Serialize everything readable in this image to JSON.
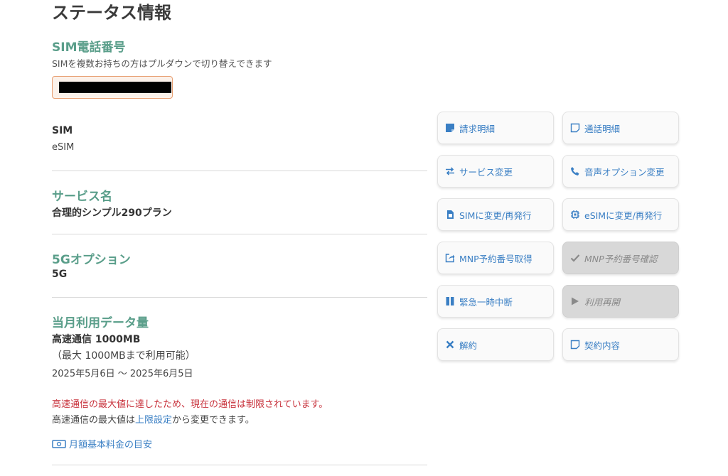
{
  "page": {
    "title": "ステータス情報"
  },
  "sim_number": {
    "title": "SIM電話番号",
    "hint": "SIMを複数お持ちの方はプルダウンで切り替えできます"
  },
  "sim": {
    "label": "SIM",
    "value": "eSIM"
  },
  "service": {
    "title": "サービス名",
    "value": "合理的シンプル290プラン"
  },
  "option5g": {
    "title": "5Gオプション",
    "value": "5G"
  },
  "data_usage": {
    "title": "当月利用データ量",
    "value": "高速通信 1000MB",
    "max": "（最大 1000MBまで利用可能）",
    "period": "2025年5月6日 〜 2025年6月5日",
    "warning": "高速通信の最大値に達したため、現在の通信は制限されています。",
    "note_prefix": "高速通信の最大値は",
    "note_link": "上限設定",
    "note_suffix": "から変更できます。",
    "fee_link": "月額基本料金の目安"
  },
  "actions": {
    "billing": "請求明細",
    "call_details": "通話明細",
    "service_change": "サービス変更",
    "voice_option": "音声オプション変更",
    "to_sim": "SIMに変更/再発行",
    "to_esim": "eSIMに変更/再発行",
    "mnp_get": "MNP予約番号取得",
    "mnp_confirm": "MNP予約番号確認",
    "suspend": "緊急一時中断",
    "resume": "利用再開",
    "cancel": "解約",
    "contract": "契約内容"
  },
  "colors": {
    "accent": "#5a9e8a",
    "link": "#3a7fc4",
    "warning": "#c8323c",
    "select_border": "#e8a073"
  }
}
